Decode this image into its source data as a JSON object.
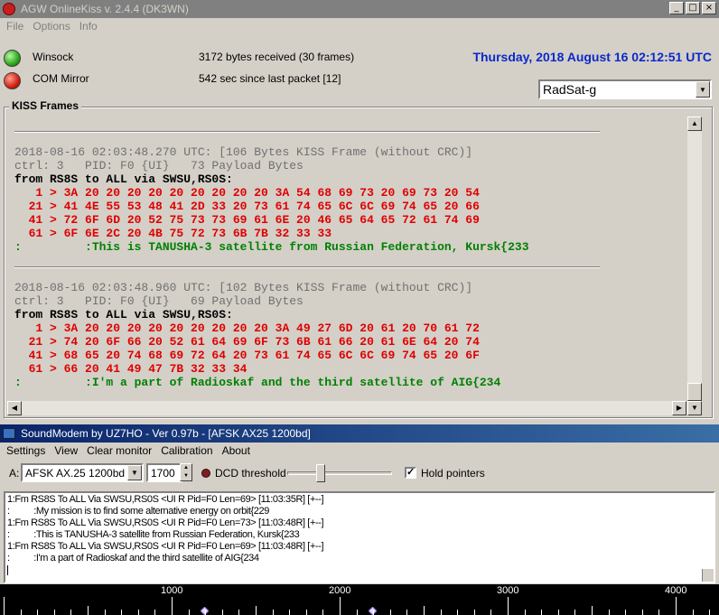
{
  "agw": {
    "title": "AGW OnlineKiss  v. 2.4.4   (DK3WN)",
    "menu": [
      "File",
      "Options",
      "Info"
    ],
    "status": [
      {
        "label": "Winsock",
        "info": "3172 bytes received (30 frames)",
        "led": "green"
      },
      {
        "label": "COM Mirror",
        "info": "542 sec since last packet [12]",
        "led": "red"
      }
    ],
    "datetime": "Thursday, 2018 August 16  02:12:51 UTC",
    "satellite_select": "RadSat-g",
    "group_title": "KISS Frames",
    "frames": [
      {
        "header": "2018-08-16 02:03:48.270 UTC: [106 Bytes KISS Frame (without CRC)]",
        "ctrl": "ctrl: 3   PID: F0 {UI}   73 Payload Bytes",
        "from": "from RS8S to ALL via SWSU,RS0S:",
        "hex": [
          "   1 > 3A 20 20 20 20 20 20 20 20 20 3A 54 68 69 73 20 69 73 20 54",
          "  21 > 41 4E 55 53 48 41 2D 33 20 73 61 74 65 6C 6C 69 74 65 20 66",
          "  41 > 72 6F 6D 20 52 75 73 73 69 61 6E 20 46 65 64 65 72 61 74 69",
          "  61 > 6F 6E 2C 20 4B 75 72 73 6B 7B 32 33 33"
        ],
        "payload": ":         :This is TANUSHA-3 satellite from Russian Federation, Kursk{233"
      },
      {
        "header": "2018-08-16 02:03:48.960 UTC: [102 Bytes KISS Frame (without CRC)]",
        "ctrl": "ctrl: 3   PID: F0 {UI}   69 Payload Bytes",
        "from": "from RS8S to ALL via SWSU,RS0S:",
        "hex": [
          "   1 > 3A 20 20 20 20 20 20 20 20 20 3A 49 27 6D 20 61 20 70 61 72",
          "  21 > 74 20 6F 66 20 52 61 64 69 6F 73 6B 61 66 20 61 6E 64 20 74",
          "  41 > 68 65 20 74 68 69 72 64 20 73 61 74 65 6C 6C 69 74 65 20 6F",
          "  61 > 66 20 41 49 47 7B 32 33 34"
        ],
        "payload": ":         :I'm a part of Radioskaf and the third satellite of AIG{234"
      }
    ]
  },
  "soundmodem": {
    "title": "SoundModem by UZ7HO - Ver 0.97b - [AFSK AX25 1200bd]",
    "menu": [
      "Settings",
      "View",
      "Clear monitor",
      "Calibration",
      "About"
    ],
    "channel_label": "A:",
    "mode": "AFSK AX.25 1200bd",
    "frequency": "1700",
    "dcd_label": "DCD threshold",
    "dcd_threshold_fraction": 0.3,
    "hold_label": "Hold pointers",
    "hold_checked": true,
    "log": [
      "1:Fm RS8S To ALL Via SWSU,RS0S <UI R Pid=F0 Len=69> [11:03:35R] [+--]",
      ":          :My mission is to find some alternative energy on orbit{229",
      "1:Fm RS8S To ALL Via SWSU,RS0S <UI R Pid=F0 Len=73> [11:03:48R] [+--]",
      ":          :This is TANUSHA-3 satellite from Russian Federation, Kursk{233",
      "1:Fm RS8S To ALL Via SWSU,RS0S <UI R Pid=F0 Len=69> [11:03:48R] [+--]",
      ":          :I'm a part of Radioskaf and the third satellite of AIG{234"
    ],
    "ruler_labels": [
      "1000",
      "2000",
      "3000",
      "4000"
    ]
  }
}
